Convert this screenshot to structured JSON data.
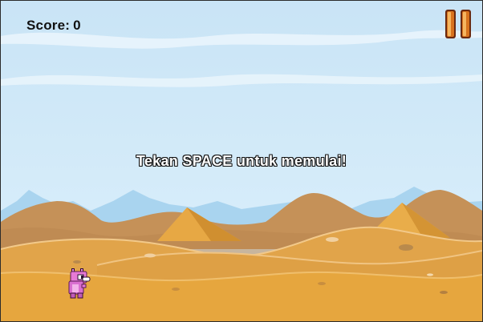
{
  "hud": {
    "score_label": "Score:",
    "score_value": "0"
  },
  "overlay": {
    "start_message": "Tekan SPACE untuk memulai!"
  },
  "icons": {
    "pause": "pause-icon",
    "player": "pink-creature-sprite"
  },
  "colors": {
    "sky": "#cfe7f8",
    "far_mountains": "#a8d3ee",
    "dunes_back": "#c79055",
    "pyramid": "#e0a040",
    "sand_front": "#e3a440",
    "player": "#e77ad6",
    "pause_button": "#d8731e"
  }
}
